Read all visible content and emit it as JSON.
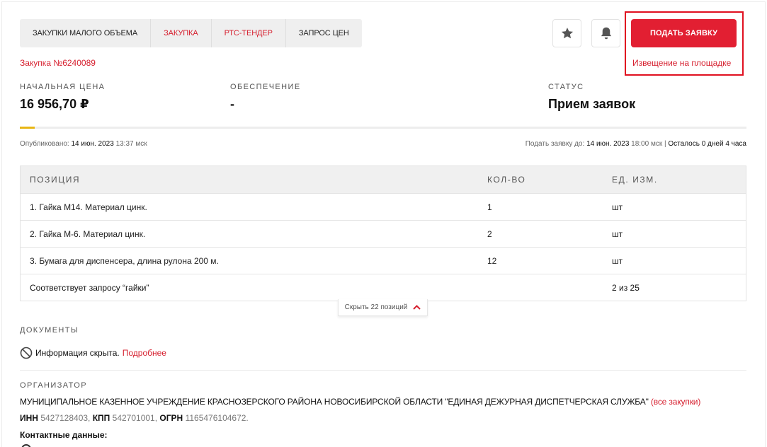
{
  "tabs": [
    {
      "label": "ЗАКУПКИ МАЛОГО ОБЪЕМА",
      "accent": false
    },
    {
      "label": "ЗАКУПКА",
      "accent": true
    },
    {
      "label": "РТС-ТЕНДЕР",
      "accent": true
    },
    {
      "label": "ЗАПРОС ЦЕН",
      "accent": false
    }
  ],
  "actions": {
    "star_icon": "star-icon",
    "bell_icon": "bell-icon",
    "submit_label": "ПОДАТЬ ЗАЯВКУ",
    "notice_link": "Извещение на площадке"
  },
  "purchase": {
    "number": "Закупка №6240089"
  },
  "summary": {
    "price_label": "НАЧАЛЬНАЯ ЦЕНА",
    "price_value": "16 956,70 ₽",
    "security_label": "ОБЕСПЕЧЕНИЕ",
    "security_value": "-",
    "status_label": "СТАТУС",
    "status_value": "Прием заявок"
  },
  "progress": {
    "fraction": 0.02
  },
  "dates": {
    "published_prefix": "Опубликовано:",
    "published_date": "14 июн. 2023",
    "published_time": "13:37 мск",
    "deadline_prefix": "Подать заявку до:",
    "deadline_date": "14 июн. 2023",
    "deadline_time": "18:00 мск",
    "separator": "|",
    "remaining": "Осталось 0 дней 4 часа"
  },
  "positions": {
    "headers": [
      "ПОЗИЦИЯ",
      "КОЛ-ВО",
      "ЕД. ИЗМ."
    ],
    "rows": [
      {
        "name": "1.  Гайка М14. Материал цинк.",
        "qty": "1",
        "unit": "шт"
      },
      {
        "name": "2.  Гайка М-6. Материал цинк.",
        "qty": "2",
        "unit": "шт"
      },
      {
        "name": "3. Бумага для диспенсера, длина рулона 200 м.",
        "qty": "12",
        "unit": "шт"
      }
    ],
    "match_text": "Соответствует запросу  “гайки”",
    "match_count": "2 из 25",
    "collapse_label": "Скрыть 22 позиций"
  },
  "documents": {
    "label": "ДОКУМЕНТЫ",
    "hidden_text": "Информация скрыта.",
    "more_link": "Подробнее"
  },
  "organizer": {
    "label": "ОРГАНИЗАТОР",
    "name": "МУНИЦИПАЛЬНОЕ КАЗЕННОЕ УЧРЕЖДЕНИЕ КРАСНОЗЕРСКОГО РАЙОНА НОВОСИБИРСКОЙ ОБЛАСТИ \"ЕДИНАЯ ДЕЖУРНАЯ ДИСПЕТЧЕРСКАЯ СЛУЖБА\"",
    "all_link": "(все закупки)",
    "inn_label": "ИНН",
    "inn": "5427128403,",
    "kpp_label": "КПП",
    "kpp": "542701001,",
    "ogrn_label": "ОГРН",
    "ogrn": "1165476104672.",
    "contacts_label": "Контактные данные:"
  },
  "colors": {
    "accent": "#e21f32",
    "progress": "#e8b614"
  }
}
